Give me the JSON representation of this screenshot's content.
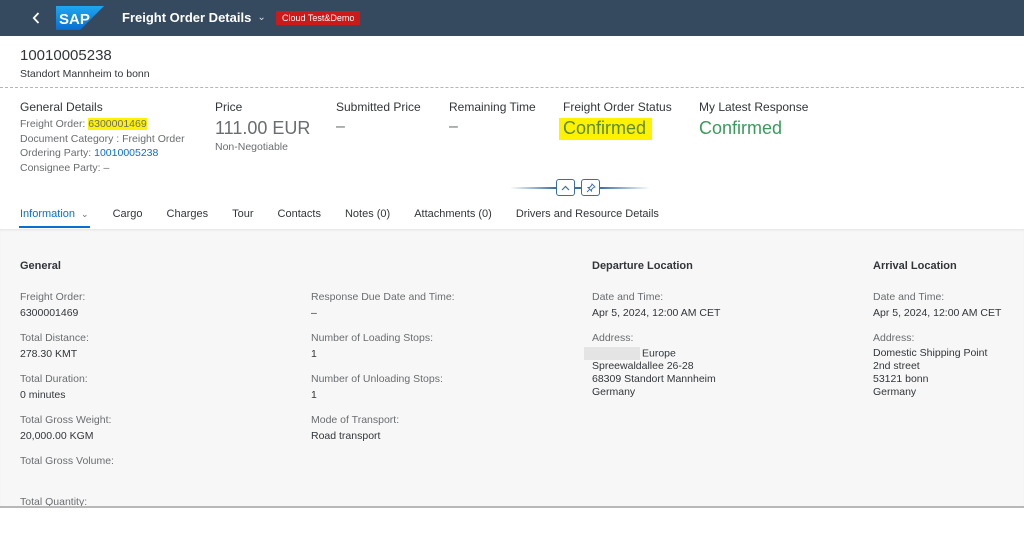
{
  "shell": {
    "back_icon": "chevron-left-icon",
    "logo_text": "SAP",
    "app_title": "Freight Order Details",
    "title_menu_icon": "chevron-down-icon",
    "environment_badge": "Cloud Test&Demo",
    "badge_color": "#cc1919",
    "bar_color": "#354a5f"
  },
  "header": {
    "title": "10010005238",
    "subtitle": "Standort Mannheim to bonn"
  },
  "kpis": {
    "general_details": {
      "label": "General Details",
      "freight_order_label": "Freight Order: ",
      "freight_order_value": "6300001469",
      "document_category": "Document Category : Freight Order",
      "ordering_party_label": "Ordering Party: ",
      "ordering_party_value": "10010005238",
      "consignee_party": "Consignee Party: –"
    },
    "price": {
      "label": "Price",
      "value": "111.00 EUR",
      "note": "Non-Negotiable"
    },
    "submitted_price": {
      "label": "Submitted Price",
      "value": "–"
    },
    "remaining_time": {
      "label": "Remaining Time",
      "value": "–"
    },
    "freight_order_status": {
      "label": "Freight Order Status",
      "value": "Confirmed"
    },
    "my_latest_response": {
      "label": "My Latest Response",
      "value": "Confirmed"
    }
  },
  "header_controls": {
    "collapse_icon": "chevron-up-icon",
    "pin_icon": "pin-icon"
  },
  "tabs": [
    {
      "label": "Information",
      "active": true,
      "has_menu": true
    },
    {
      "label": "Cargo"
    },
    {
      "label": "Charges"
    },
    {
      "label": "Tour"
    },
    {
      "label": "Contacts"
    },
    {
      "label": "Notes (0)"
    },
    {
      "label": "Attachments (0)"
    },
    {
      "label": "Drivers and Resource Details"
    }
  ],
  "general": {
    "title": "General",
    "fields": [
      {
        "label": "Freight Order:",
        "value": "6300001469"
      },
      {
        "label": "Total Distance:",
        "value": "278.30 KMT"
      },
      {
        "label": "Total Duration:",
        "value": "0 minutes"
      },
      {
        "label": "Total Gross Weight:",
        "value": "20,000.00 KGM"
      },
      {
        "label": "Total Gross Volume:",
        "value": ""
      },
      {
        "label": "Total Quantity:",
        "value": ""
      }
    ],
    "fields_col2": [
      {
        "label": "Response Due Date and Time:",
        "value": "–"
      },
      {
        "label": "Number of Loading Stops:",
        "value": "1"
      },
      {
        "label": "Number of Unloading Stops:",
        "value": "1"
      },
      {
        "label": "Mode of Transport:",
        "value": "Road transport"
      }
    ]
  },
  "departure": {
    "title": "Departure Location",
    "date_label": "Date and Time:",
    "date_value": "Apr 5, 2024, 12:00 AM CET",
    "address_label": "Address:",
    "address_lines": [
      "Europe",
      "Spreewaldallee 26-28",
      "68309 Standort Mannheim",
      "Germany"
    ]
  },
  "arrival": {
    "title": "Arrival Location",
    "date_label": "Date and Time:",
    "date_value": "Apr 5, 2024, 12:00 AM CET",
    "address_label": "Address:",
    "address_lines": [
      "Domestic Shipping Point",
      "2nd street",
      "53121 bonn",
      "Germany"
    ]
  }
}
